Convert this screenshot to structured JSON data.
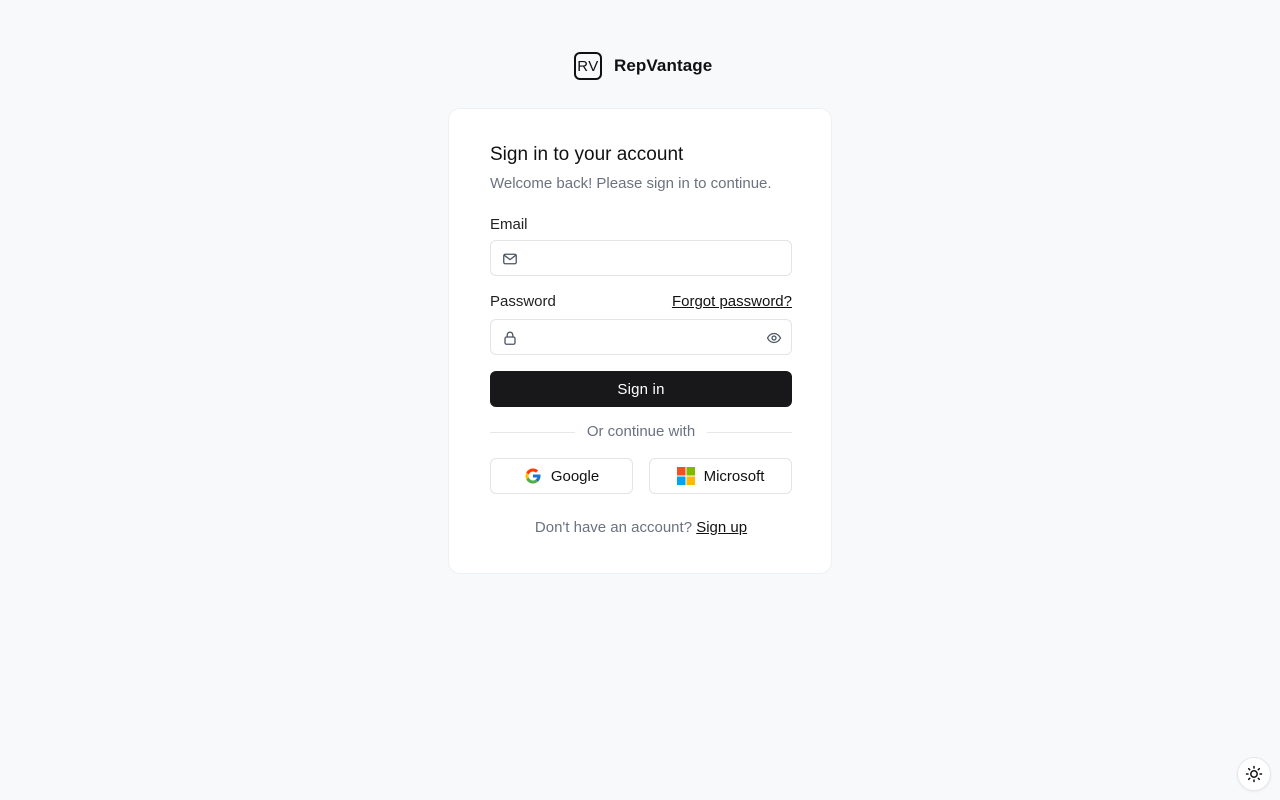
{
  "brand": {
    "logo_text": "RV",
    "name": "RepVantage"
  },
  "signin_card": {
    "title": "Sign in to your account",
    "subtitle": "Welcome back! Please sign in to continue.",
    "email": {
      "label": "Email",
      "value": "",
      "placeholder": "",
      "icon": "mail-icon"
    },
    "password": {
      "label": "Password",
      "value": "",
      "placeholder": "",
      "icon": "lock-icon",
      "toggle_icon": "eye-icon",
      "forgot_label": "Forgot password?"
    },
    "submit_label": "Sign in",
    "divider_text": "Or continue with",
    "oauth": [
      {
        "label": "Google",
        "icon": "google-icon"
      },
      {
        "label": "Microsoft",
        "icon": "microsoft-icon"
      }
    ],
    "footer": {
      "prompt": "Don't have an account?",
      "link_label": "Sign up"
    }
  },
  "theme_toggle": {
    "icon": "sun-icon"
  },
  "colors": {
    "background": "#f8f9fb",
    "primary_button": "#18181b",
    "muted_text": "#6b7280",
    "border": "#e2e4e8"
  }
}
